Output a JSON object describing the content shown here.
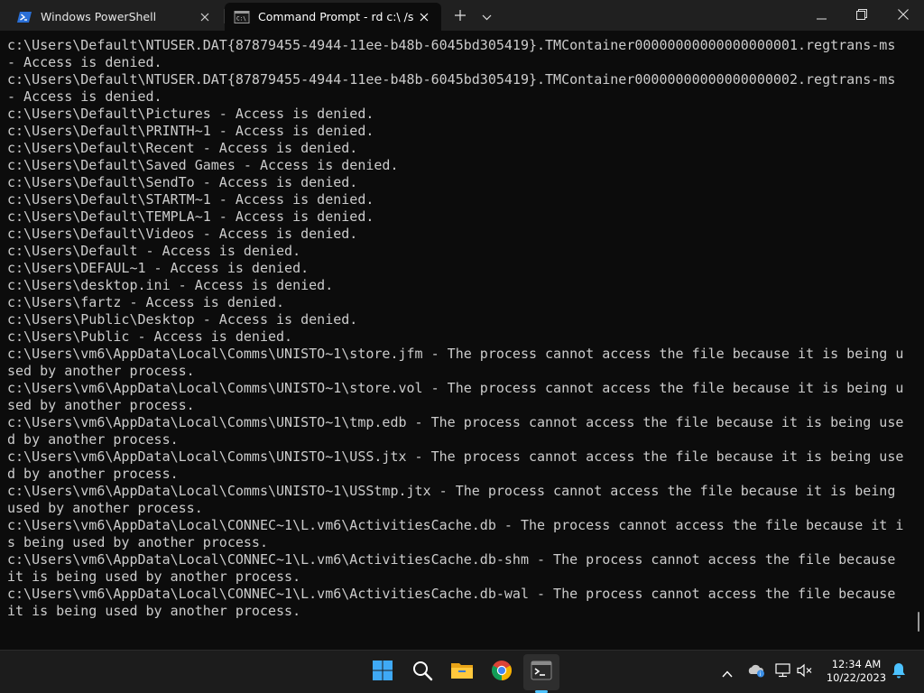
{
  "tabs": [
    {
      "title": "Windows PowerShell",
      "icon": "powershell-icon",
      "active": false
    },
    {
      "title": "Command Prompt - rd  c:\\ /s /q",
      "icon": "cmd-icon",
      "active": true
    }
  ],
  "titlebar": {
    "new_tab_icon": "plus-icon",
    "dropdown_icon": "chevron-down-icon",
    "window_controls": [
      "minimize-icon",
      "maximize-icon",
      "close-icon"
    ]
  },
  "console": {
    "lines": [
      "c:\\Users\\Default\\NTUSER.DAT{87879455-4944-11ee-b48b-6045bd305419}.TMContainer00000000000000000001.regtrans-ms",
      "- Access is denied.",
      "c:\\Users\\Default\\NTUSER.DAT{87879455-4944-11ee-b48b-6045bd305419}.TMContainer00000000000000000002.regtrans-ms",
      "- Access is denied.",
      "c:\\Users\\Default\\Pictures - Access is denied.",
      "c:\\Users\\Default\\PRINTH~1 - Access is denied.",
      "c:\\Users\\Default\\Recent - Access is denied.",
      "c:\\Users\\Default\\Saved Games - Access is denied.",
      "c:\\Users\\Default\\SendTo - Access is denied.",
      "c:\\Users\\Default\\STARTM~1 - Access is denied.",
      "c:\\Users\\Default\\TEMPLA~1 - Access is denied.",
      "c:\\Users\\Default\\Videos - Access is denied.",
      "c:\\Users\\Default - Access is denied.",
      "c:\\Users\\DEFAUL~1 - Access is denied.",
      "c:\\Users\\desktop.ini - Access is denied.",
      "c:\\Users\\fartz - Access is denied.",
      "c:\\Users\\Public\\Desktop - Access is denied.",
      "c:\\Users\\Public - Access is denied.",
      "c:\\Users\\vm6\\AppData\\Local\\Comms\\UNISTO~1\\store.jfm - The process cannot access the file because it is being u",
      "sed by another process.",
      "c:\\Users\\vm6\\AppData\\Local\\Comms\\UNISTO~1\\store.vol - The process cannot access the file because it is being u",
      "sed by another process.",
      "c:\\Users\\vm6\\AppData\\Local\\Comms\\UNISTO~1\\tmp.edb - The process cannot access the file because it is being use",
      "d by another process.",
      "c:\\Users\\vm6\\AppData\\Local\\Comms\\UNISTO~1\\USS.jtx - The process cannot access the file because it is being use",
      "d by another process.",
      "c:\\Users\\vm6\\AppData\\Local\\Comms\\UNISTO~1\\USStmp.jtx - The process cannot access the file because it is being",
      "used by another process.",
      "c:\\Users\\vm6\\AppData\\Local\\CONNEC~1\\L.vm6\\ActivitiesCache.db - The process cannot access the file because it i",
      "s being used by another process.",
      "c:\\Users\\vm6\\AppData\\Local\\CONNEC~1\\L.vm6\\ActivitiesCache.db-shm - The process cannot access the file because",
      "it is being used by another process.",
      "c:\\Users\\vm6\\AppData\\Local\\CONNEC~1\\L.vm6\\ActivitiesCache.db-wal - The process cannot access the file because",
      "it is being used by another process."
    ]
  },
  "taskbar": {
    "apps": [
      {
        "name": "Start",
        "icon": "windows-start-icon"
      },
      {
        "name": "Search",
        "icon": "search-icon"
      },
      {
        "name": "File Explorer",
        "icon": "folder-icon"
      },
      {
        "name": "Google Chrome",
        "icon": "chrome-icon"
      },
      {
        "name": "Terminal",
        "icon": "terminal-icon",
        "active": true
      }
    ],
    "tray": {
      "time": "12:34 AM",
      "date": "10/22/2023",
      "icons": [
        "chevron-up-icon",
        "weather-icon",
        "network-icon",
        "volume-muted-icon",
        "bell-icon"
      ]
    }
  },
  "colors": {
    "console_bg": "#0c0c0c",
    "console_text": "#cccccc",
    "titlebar_bg": "#202020",
    "taskbar_bg": "#1c1c1c",
    "accent": "#4cc2ff"
  }
}
